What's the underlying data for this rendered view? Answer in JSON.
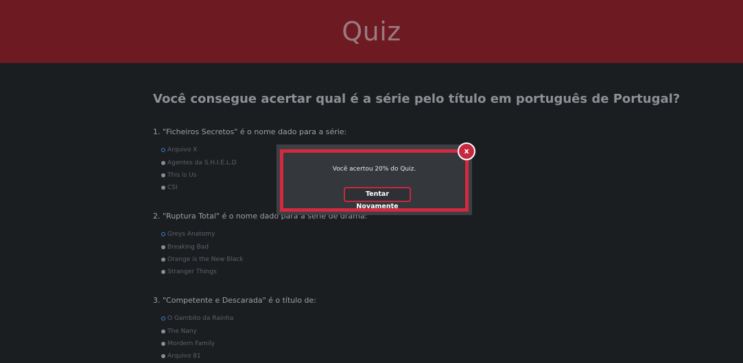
{
  "header": {
    "title": "Quiz"
  },
  "main": {
    "subtitle": "Você consegue acertar qual é a série pelo título em português de Portugal?",
    "questions": [
      {
        "text": "1. \"Ficheiros Secretos\" é o nome dado para a série:",
        "selected_index": 0,
        "options": [
          "Arquivo X",
          "Agentes da S.H.I.E.L.D",
          "This is Us",
          "CSI"
        ]
      },
      {
        "text": "2. \"Ruptura Total\" é o nome dado para a série de drama:",
        "selected_index": 0,
        "options": [
          "Greys Anatomy",
          "Breaking Bad",
          "Orange is the New Black",
          "Stranger Things"
        ]
      },
      {
        "text": "3. \"Competente e Descarada\" é o título de:",
        "selected_index": 0,
        "options": [
          "O Gambito da Rainha",
          "The Nany",
          "Mordern Family",
          "Arquivo 81"
        ]
      }
    ]
  },
  "modal": {
    "message": "Você acertou 20% do Quiz.",
    "retry_label": "Tentar Novamente",
    "close_label": "x"
  },
  "colors": {
    "header_bg": "#6e1a22",
    "page_bg": "#1b1e21",
    "accent_red": "#d4293f",
    "radio_selected": "#3d7fd6"
  }
}
